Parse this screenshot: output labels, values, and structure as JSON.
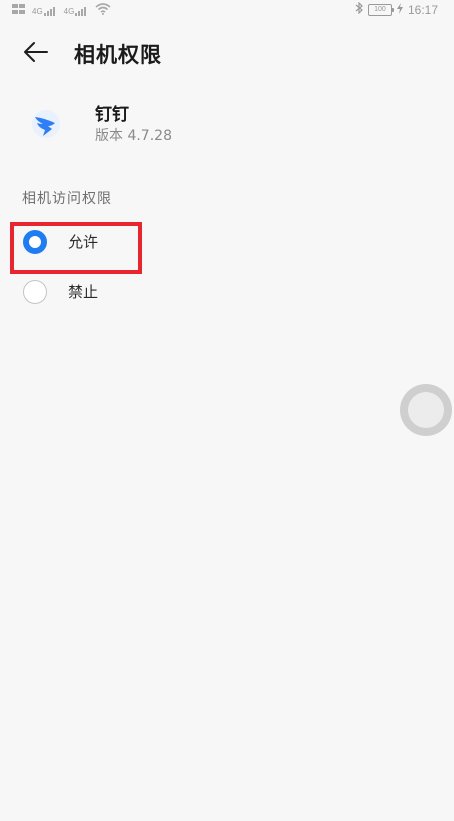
{
  "status_bar": {
    "signal_1": "4G",
    "signal_2": "4G",
    "battery": "100",
    "time": "16:17",
    "icons": [
      "signal-icon",
      "wifi-icon",
      "bluetooth-icon",
      "battery-icon",
      "charging-icon"
    ]
  },
  "header": {
    "title": "相机权限",
    "back_icon": "back-arrow-icon"
  },
  "app": {
    "name": "钉钉",
    "version": "版本 4.7.28",
    "icon": "dingtalk-logo-icon",
    "brand_color": "#2f7ef6"
  },
  "permission": {
    "section_title": "相机访问权限",
    "options": [
      {
        "label": "允许",
        "selected": true
      },
      {
        "label": "禁止",
        "selected": false
      }
    ]
  },
  "colors": {
    "accent": "#1f7cf1",
    "highlight": "#e8262e",
    "background": "#f7f7f8"
  }
}
